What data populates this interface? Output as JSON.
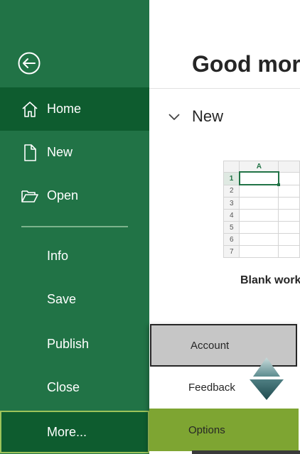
{
  "sidebar": {
    "back_icon": "back-arrow-icon",
    "items": [
      {
        "id": "home",
        "label": "Home",
        "icon": "home-icon",
        "selected": true
      },
      {
        "id": "new",
        "label": "New",
        "icon": "new-document-icon"
      },
      {
        "id": "open",
        "label": "Open",
        "icon": "open-folder-icon"
      },
      {
        "id": "info",
        "label": "Info"
      },
      {
        "id": "save",
        "label": "Save"
      },
      {
        "id": "publish",
        "label": "Publish"
      },
      {
        "id": "close",
        "label": "Close"
      },
      {
        "id": "more",
        "label": "More..."
      }
    ]
  },
  "main": {
    "greeting": "Good morn",
    "section": {
      "title": "New",
      "chevron_icon": "chevron-down-icon"
    },
    "template": {
      "caption": "Blank work",
      "column_header": "A",
      "row_numbers": [
        "1",
        "2",
        "3",
        "4",
        "5",
        "6",
        "7"
      ]
    }
  },
  "flyout": {
    "items": [
      {
        "id": "account",
        "label": "Account"
      },
      {
        "id": "feedback",
        "label": "Feedback"
      },
      {
        "id": "options",
        "label": "Options"
      }
    ],
    "scroll_icon": "scroll-arrows-icon"
  },
  "colors": {
    "sidebar_bg": "#217346",
    "sidebar_selected": "#0e5c2f",
    "options_highlight": "#7ea532",
    "account_bg": "#c6c6c6",
    "more_border": "#9cc35a"
  }
}
